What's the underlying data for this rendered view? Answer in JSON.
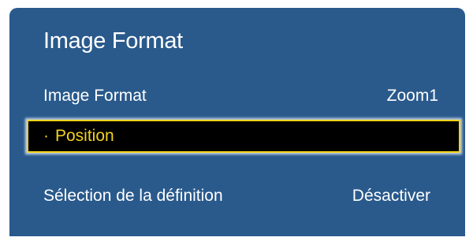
{
  "menu": {
    "title": "Image Format",
    "items": [
      {
        "label": "Image Format",
        "value": "Zoom1"
      },
      {
        "bullet": "·",
        "label": "Position",
        "value": ""
      },
      {
        "label": "Sélection de la définition",
        "value": "Désactiver"
      }
    ]
  },
  "colors": {
    "panel_background": "#2a5a8c",
    "text": "#ffffff",
    "selected_background": "#000000",
    "selected_text": "#f3d21c",
    "selected_border": "#f3d21c"
  }
}
